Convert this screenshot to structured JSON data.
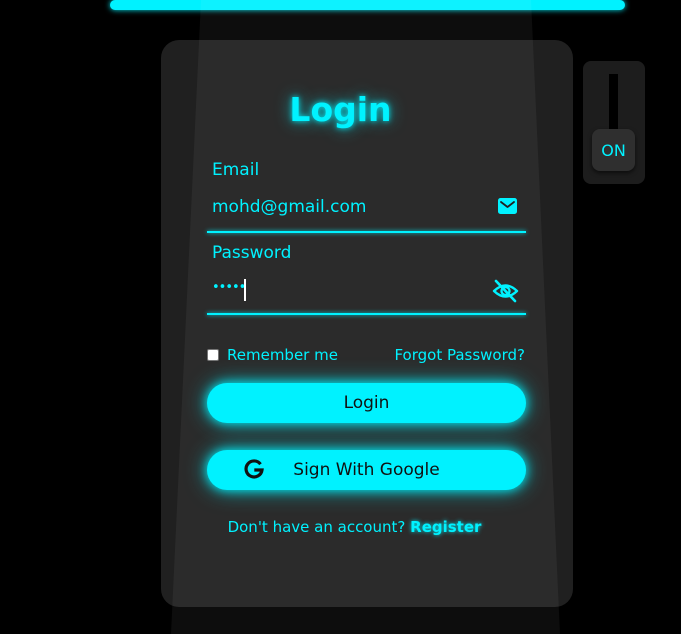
{
  "login_form": {
    "title": "Login",
    "email": {
      "label": "Email",
      "value": "mohd@gmail.com",
      "icon": "envelope-icon"
    },
    "password": {
      "label": "Password",
      "value": "•••••",
      "icon": "eye-slash-icon"
    },
    "remember_label": "Remember me",
    "remember_checked": false,
    "forgot_label": "Forgot Password?",
    "login_button": "Login",
    "google_button": "Sign With Google",
    "google_icon": "google-g-icon",
    "register_prompt": "Don't have an account?",
    "register_link": "Register"
  },
  "lamp_toggle": {
    "label": "ON",
    "state": "on"
  },
  "colors": {
    "accent": "#00f2ff",
    "background": "#000000",
    "card": "#202020",
    "toggle_box": "#1d1d1d"
  }
}
